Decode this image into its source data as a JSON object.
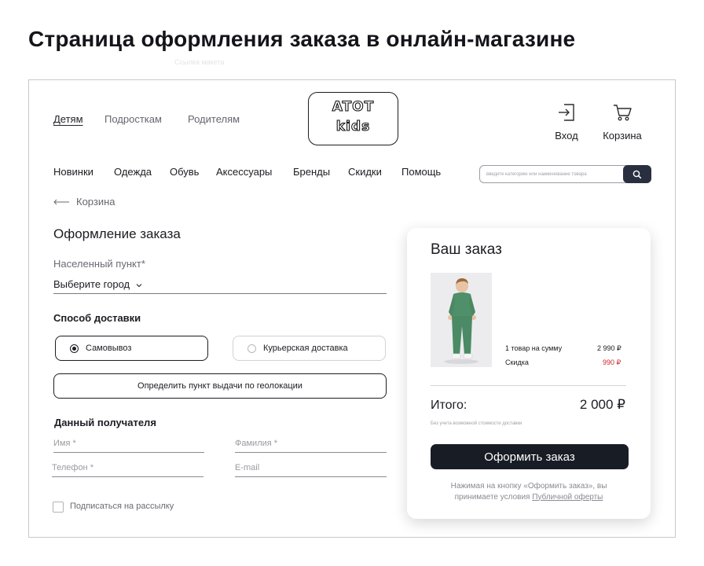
{
  "page_heading": "Страница оформления заказа в онлайн-магазине",
  "ghost_text": "Ссылка макета",
  "audience_nav": [
    "Детям",
    "Подросткам",
    "Родителям"
  ],
  "logo": {
    "line1": "ATOT",
    "line2": "kids"
  },
  "header_actions": {
    "login": "Вход",
    "cart": "Корзина"
  },
  "category_nav": [
    "Новинки",
    "Одежда",
    "Обувь",
    "Аксессуары",
    "Бренды",
    "Скидки",
    "Помощь"
  ],
  "search": {
    "placeholder": "введите категорию или наименование товара"
  },
  "back_link": "Корзина",
  "checkout": {
    "title": "Оформление заказа",
    "city_label": "Населенный пункт*",
    "city_value": "Выберите город",
    "delivery_title": "Способ доставки",
    "delivery_options": [
      "Самовывоз",
      "Курьерская доставка"
    ],
    "delivery_selected": "Самовывоз",
    "geo_button": "Определить пункт выдачи по геолокации",
    "recipient_title": "Данный получателя",
    "fields": {
      "first_name": "Имя *",
      "last_name": "Фамилия *",
      "phone": "Телефон *",
      "email": "E-mail"
    },
    "newsletter_label": "Подписаться на рассылку",
    "newsletter_checked": false
  },
  "order": {
    "title": "Ваш заказ",
    "items_label": "1 товар на сумму",
    "items_sum": "2 990 ₽",
    "discount_label": "Скидка",
    "discount_value": "990 ₽",
    "total_label": "Итого:",
    "total_value": "2 000 ₽",
    "total_note": "Без учета возможной стоимости доставки",
    "checkout_button": "Оформить заказ",
    "disclaimer": "Нажимая на кнопку «Оформить заказ», вы принимаете условия",
    "offer_link": "Публичной оферты"
  },
  "colors": {
    "accent_dark": "#181c25",
    "search_button": "#2a2f40",
    "discount": "#d0262e",
    "product_outfit": "#4f8f6a"
  },
  "icons": {
    "login": "login-arrow-icon",
    "cart": "shopping-cart-icon",
    "search": "magnifier-icon",
    "back": "long-arrow-left-icon",
    "dropdown": "chevron-down-icon"
  }
}
